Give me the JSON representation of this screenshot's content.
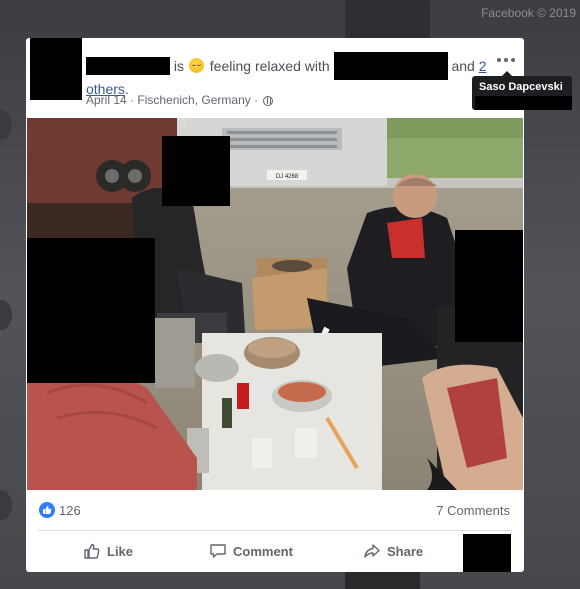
{
  "background": {
    "copyright": "Facebook © 2019"
  },
  "post": {
    "status_is": "is",
    "feeling": "feeling relaxed with",
    "and": "and",
    "others_count": "2",
    "others": "others",
    "period": ".",
    "date": "April 14",
    "separator": "·",
    "location": "Fischenich, Germany",
    "truck_plate": "DJ 4268"
  },
  "stats": {
    "likes": "126",
    "comments": "7 Comments"
  },
  "actions": {
    "like": "Like",
    "comment": "Comment",
    "share": "Share"
  },
  "tooltip": {
    "name": "Saso Dapcevski"
  },
  "colors": {
    "link": "#385898",
    "like_blue": "#2e7cf6",
    "muted_text": "#606770"
  }
}
